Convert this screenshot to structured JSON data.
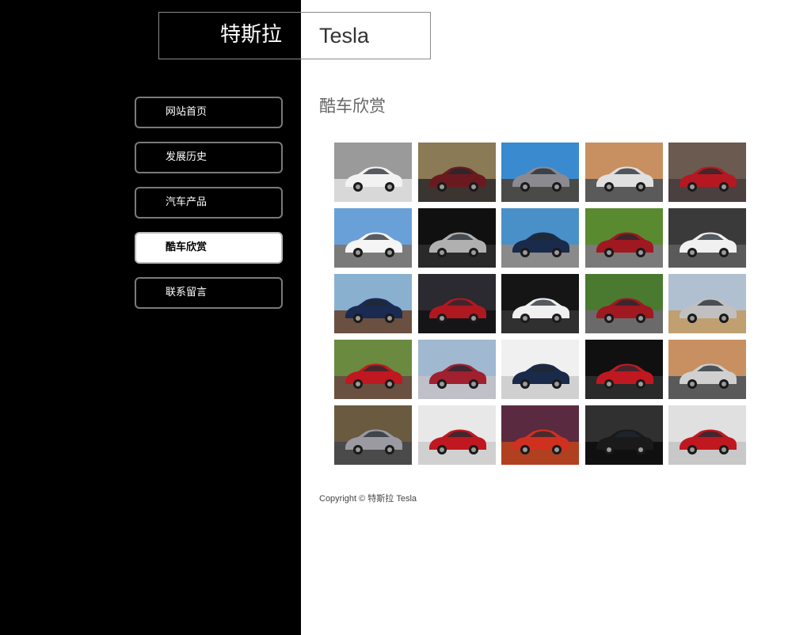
{
  "site": {
    "logo_cn": "特斯拉",
    "logo_en": "Tesla"
  },
  "nav": {
    "items": [
      {
        "label": "网站首页"
      },
      {
        "label": "发展历史"
      },
      {
        "label": "汽车产品"
      },
      {
        "label": "酷车欣赏"
      },
      {
        "label": "联系留言"
      }
    ],
    "active_index": 3
  },
  "main": {
    "title": "酷车欣赏"
  },
  "gallery": {
    "images": [
      {
        "bg": "#9a9a9a",
        "ground": "#d8d8d8",
        "car": "#f2f2f2"
      },
      {
        "bg": "#8a7a55",
        "ground": "#3a3530",
        "car": "#6a1a1e"
      },
      {
        "bg": "#3a8ad0",
        "ground": "#4a4a48",
        "car": "#8a8a90"
      },
      {
        "bg": "#c89060",
        "ground": "#5a5a5a",
        "car": "#e0e0e0"
      },
      {
        "bg": "#6a5a50",
        "ground": "#4a4040",
        "car": "#b51820"
      },
      {
        "bg": "#6aa0d8",
        "ground": "#7a7a7a",
        "car": "#f5f5f5"
      },
      {
        "bg": "#101010",
        "ground": "#2a2a2a",
        "car": "#b0b0b0"
      },
      {
        "bg": "#4a90c8",
        "ground": "#8a8a8a",
        "car": "#1a2a4a"
      },
      {
        "bg": "#5a8a30",
        "ground": "#7a7a7a",
        "car": "#a01820"
      },
      {
        "bg": "#3a3a3a",
        "ground": "#5a5a5a",
        "car": "#f0f0f0"
      },
      {
        "bg": "#8ab0d0",
        "ground": "#6a5040",
        "car": "#1a2a50"
      },
      {
        "bg": "#2a2a30",
        "ground": "#151518",
        "car": "#b01820"
      },
      {
        "bg": "#151515",
        "ground": "#303030",
        "car": "#f0f0f0"
      },
      {
        "bg": "#4a7a30",
        "ground": "#6a6a6a",
        "car": "#a01820"
      },
      {
        "bg": "#b0c0d0",
        "ground": "#c0a070",
        "car": "#c0c0c0"
      },
      {
        "bg": "#6a8a40",
        "ground": "#6a5040",
        "car": "#c01820"
      },
      {
        "bg": "#a0b8d0",
        "ground": "#c0c0c8",
        "car": "#a02030"
      },
      {
        "bg": "#f0f0f0",
        "ground": "#d0d0d0",
        "car": "#1a2a4a"
      },
      {
        "bg": "#101010",
        "ground": "#2a2a2a",
        "car": "#c01820"
      },
      {
        "bg": "#c89060",
        "ground": "#5a5a5a",
        "car": "#d0d0d0"
      },
      {
        "bg": "#6a5a40",
        "ground": "#4a4a4a",
        "car": "#9a9aa0"
      },
      {
        "bg": "#e8e8e8",
        "ground": "#d0d0d0",
        "car": "#c01820"
      },
      {
        "bg": "#5a2a40",
        "ground": "#b04020",
        "car": "#d03020"
      },
      {
        "bg": "#303030",
        "ground": "#101010",
        "car": "#1a1a1a"
      },
      {
        "bg": "#e0e0e0",
        "ground": "#c8c8c8",
        "car": "#c01820"
      }
    ]
  },
  "footer": {
    "copyright": "Copyright © 特斯拉 Tesla"
  }
}
